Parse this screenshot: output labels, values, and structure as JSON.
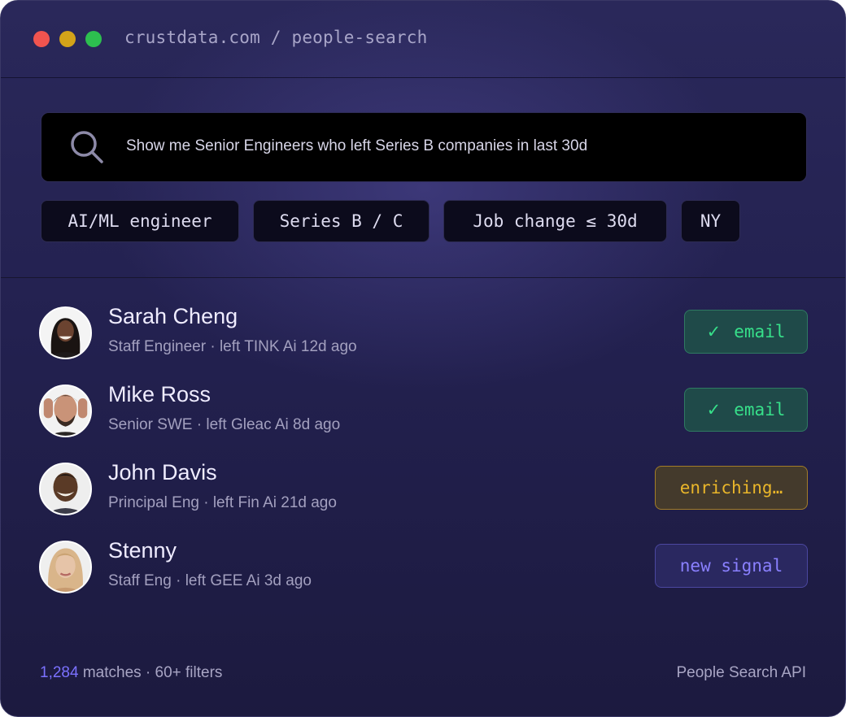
{
  "window": {
    "url": "crustdata.com / people-search"
  },
  "search": {
    "query": "Show me Senior Engineers who left Series B companies in last 30d",
    "icon": "search-icon"
  },
  "filters": [
    {
      "label": "AI/ML engineer"
    },
    {
      "label": "Series B / C"
    },
    {
      "label": "Job change ≤ 30d"
    },
    {
      "label": "NY"
    }
  ],
  "people": [
    {
      "name": "Sarah Cheng",
      "meta": "Staff Engineer · left TINK Ai 12d ago",
      "status": "email",
      "status_icon": "check-icon"
    },
    {
      "name": "Mike Ross",
      "meta": "Senior SWE · left Gleac Ai 8d ago",
      "status": "email",
      "status_icon": "check-icon"
    },
    {
      "name": "John Davis",
      "meta": "Principal Eng · left Fin Ai 21d ago",
      "status": "enriching…"
    },
    {
      "name": "Stenny",
      "meta": "Staff Eng · left GEE Ai 3d ago",
      "status": "new signal"
    }
  ],
  "footer": {
    "count": "1,284",
    "matches_text": " matches · 60+ filters",
    "right": "People Search API"
  },
  "colors": {
    "background": "#232150",
    "email_badge": "#37e08a",
    "enriching_badge": "#eab62a",
    "signal_badge": "#8a80ff",
    "count_accent": "#7b71ff"
  }
}
